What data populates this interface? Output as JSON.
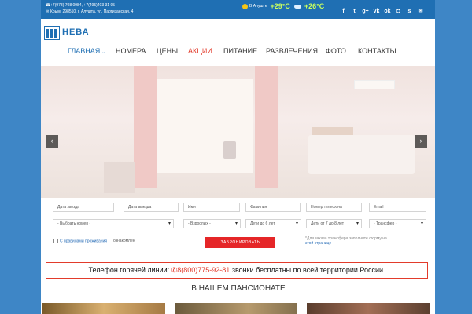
{
  "topbar": {
    "phones": "+7(978) 708 0984, +7(495)403 31 95",
    "address": "Крым, 298510, г. Алушта, ул. Партизанская, 4",
    "weather": {
      "label": "В Алуште",
      "air_temp": "+29°C",
      "water_temp": "+26°C"
    },
    "social": [
      "f-icon",
      "twitter-icon",
      "gplus-icon",
      "vk-icon",
      "ok-icon",
      "instagram-icon",
      "skype-icon",
      "mail-icon",
      "rss-icon"
    ]
  },
  "header": {
    "logo_text": "НЕВА",
    "nav": [
      "Главная",
      "Номера",
      "Цены",
      "Акции",
      "Питание",
      "Развлечения",
      "Фото",
      "Контакты"
    ]
  },
  "booking": {
    "row1": [
      "Дата заезда",
      "Дата выезда",
      "Имя",
      "Фамилия",
      "Номер телефона",
      "Email"
    ],
    "row2": [
      "- Выбрать номер -",
      "- Взрослых -",
      "Дети до 6 лет",
      "Дети от 7 до 8 лет",
      "- Трансфер -"
    ],
    "agree_text": "С правилами проживания",
    "agree_suffix": "ознакомлен",
    "submit_label": "ЗАБРОНИРОВАТЬ",
    "hint_text": "*Для заказа трансфера заполните форму на",
    "hint_link": "этой странице"
  },
  "hotline": {
    "label": "Телефон горячей линии:",
    "phone": "8(800)775-92-81",
    "suffix": "звонки бесплатны по всей территории России."
  },
  "section": {
    "title": "В НАШЕМ ПАНСИОНАТЕ"
  },
  "colors": {
    "brand": "#1f6fb3",
    "accent": "#e23b2b",
    "background": "#3e86c6"
  }
}
